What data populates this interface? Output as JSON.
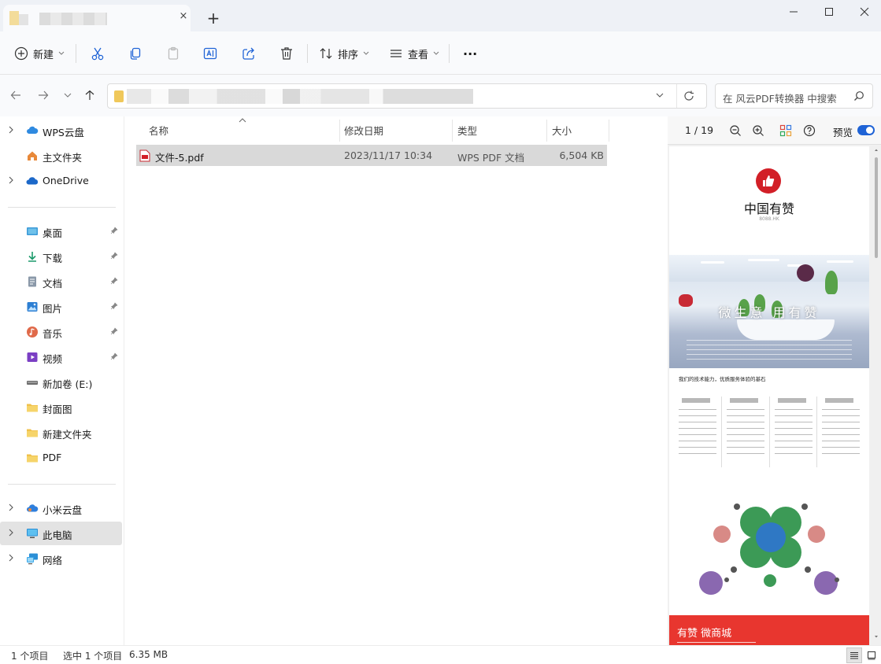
{
  "window": {
    "new_tab_symbol": "+",
    "tab_close_symbol": "×"
  },
  "toolbar": {
    "new_label": "新建",
    "sort_label": "排序",
    "view_label": "查看",
    "more_symbol": "···"
  },
  "search": {
    "placeholder": "在 风云PDF转换器 中搜索"
  },
  "sidebar": {
    "groups": {
      "cloud": [
        {
          "label": "WPS云盘",
          "icon": "cloud-icon",
          "color": "#2f8ae0"
        },
        {
          "label": "主文件夹",
          "icon": "home-icon",
          "color": "#e8893a"
        },
        {
          "label": "OneDrive",
          "icon": "onedrive-icon",
          "color": "#1c68c9"
        }
      ],
      "quick": [
        {
          "label": "桌面",
          "icon": "desktop-icon"
        },
        {
          "label": "下载",
          "icon": "download-icon"
        },
        {
          "label": "文档",
          "icon": "document-icon"
        },
        {
          "label": "图片",
          "icon": "pictures-icon"
        },
        {
          "label": "音乐",
          "icon": "music-icon"
        },
        {
          "label": "视频",
          "icon": "video-icon"
        },
        {
          "label": "新加卷 (E:)",
          "icon": "drive-icon"
        },
        {
          "label": "封面图",
          "icon": "folder-icon"
        },
        {
          "label": "新建文件夹",
          "icon": "folder-icon"
        },
        {
          "label": "PDF",
          "icon": "folder-icon"
        }
      ],
      "system": [
        {
          "label": "小米云盘",
          "icon": "cloud-icon"
        },
        {
          "label": "此电脑",
          "icon": "computer-icon",
          "selected": true
        },
        {
          "label": "网络",
          "icon": "network-icon"
        }
      ]
    }
  },
  "filelist": {
    "columns": {
      "name": "名称",
      "modified": "修改日期",
      "type": "类型",
      "size": "大小"
    },
    "rows": [
      {
        "name": "文件-5.pdf",
        "modified": "2023/11/17 10:34",
        "type": "WPS PDF 文档",
        "size": "6,504 KB",
        "selected": true
      }
    ]
  },
  "preview": {
    "page_indicator": "1 / 19",
    "toggle_label": "预览",
    "doc": {
      "brand": "中国有赞",
      "brand_sub": "8088.HK",
      "photo_title": "微生意 用有赞",
      "section_heading": "我们的技术能力，优质服务体验的基石",
      "banner_title": "有赞 微商城"
    }
  },
  "status": {
    "item_count": "1 个项目",
    "selection": "选中 1 个项目",
    "size": "6.35 MB"
  },
  "colors": {
    "accent": "#1f63d6",
    "selection": "#d9d9d9",
    "pdf_red": "#d21f27"
  }
}
